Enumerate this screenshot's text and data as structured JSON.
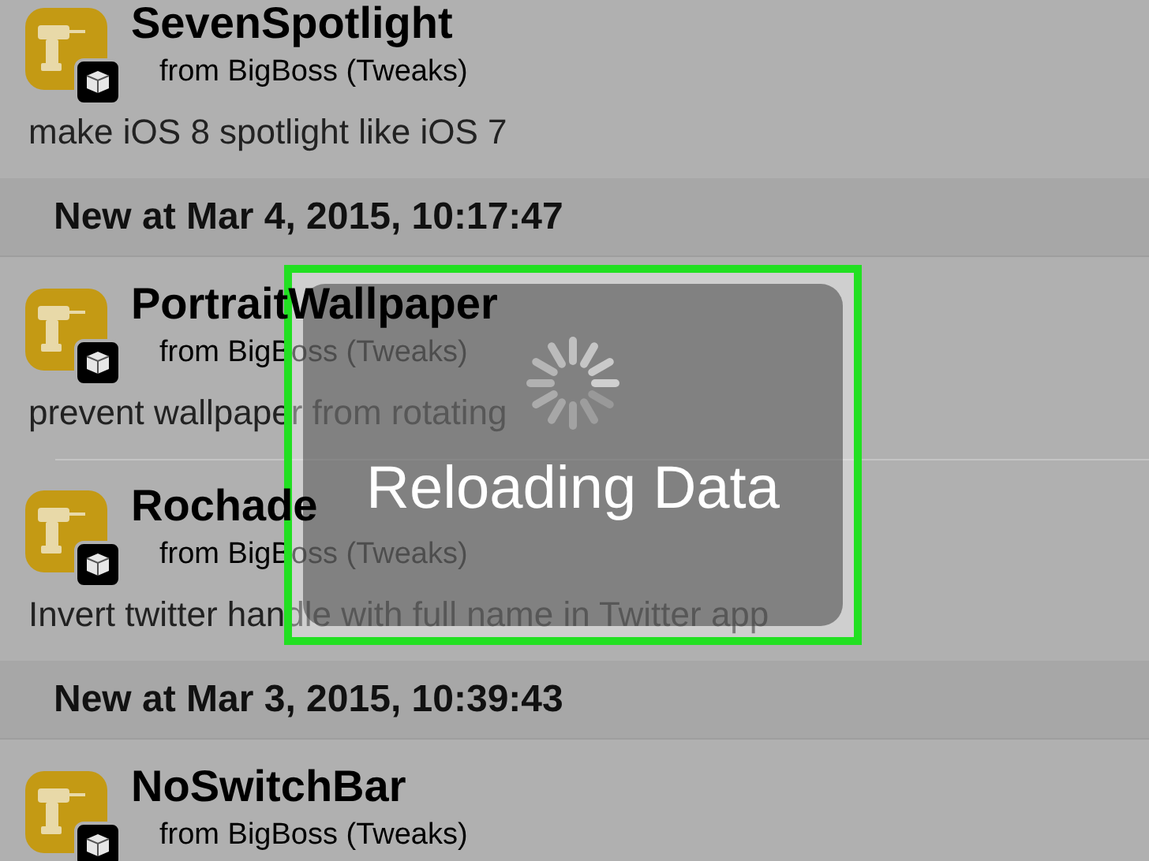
{
  "list": [
    {
      "kind": "package",
      "name": "SevenSpotlight",
      "source": "from BigBoss (Tweaks)",
      "description": "make iOS 8 spotlight like iOS 7"
    },
    {
      "kind": "header",
      "title": "New at Mar 4, 2015, 10:17:47"
    },
    {
      "kind": "package",
      "name": "PortraitWallpaper",
      "source": "from BigBoss (Tweaks)",
      "description": "prevent wallpaper from rotating"
    },
    {
      "kind": "package",
      "name": "Rochade",
      "source": "from BigBoss (Tweaks)",
      "description": "Invert twitter handle with full name in Twitter app"
    },
    {
      "kind": "header",
      "title": "New at Mar 3, 2015, 10:39:43"
    },
    {
      "kind": "package",
      "name": "NoSwitchBar",
      "source": "from BigBoss (Tweaks)"
    }
  ],
  "hud": {
    "message": "Reloading Data"
  }
}
